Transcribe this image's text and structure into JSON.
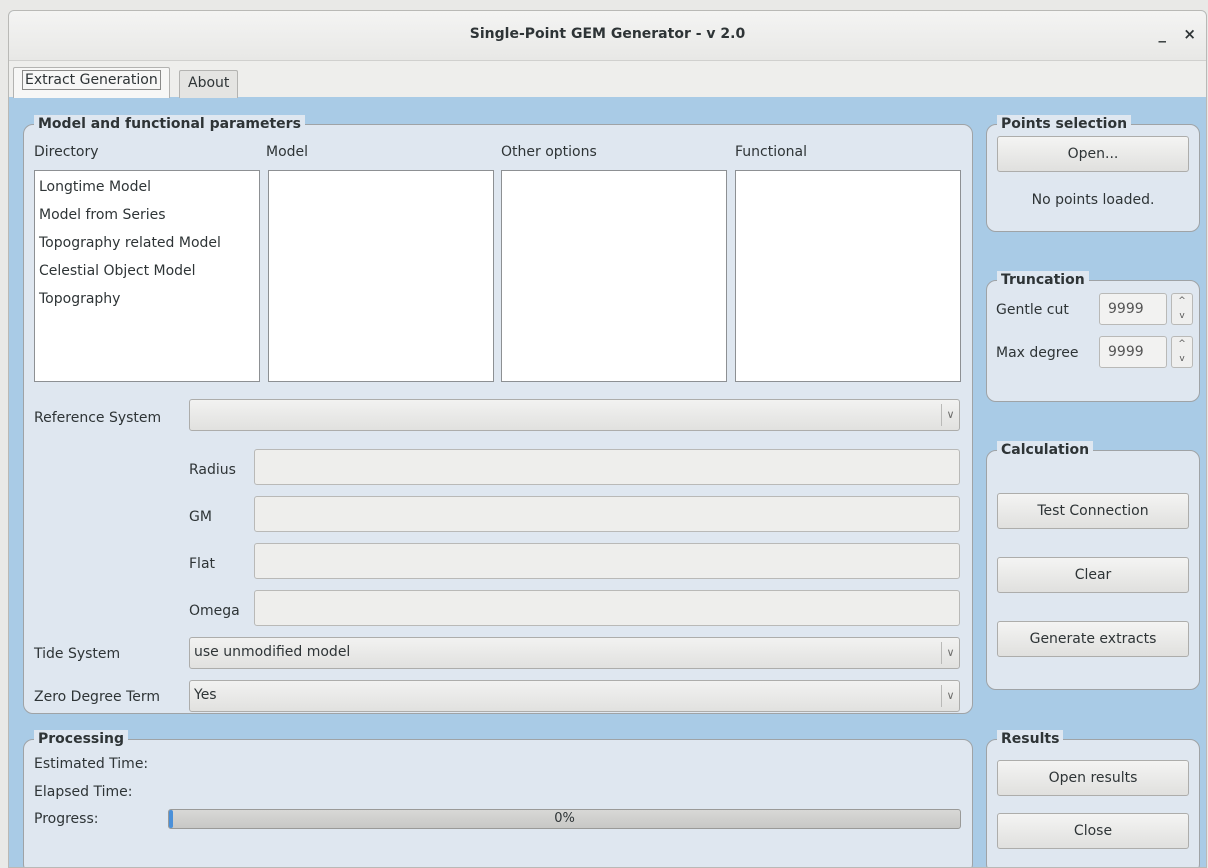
{
  "window": {
    "title": "Single-Point GEM Generator - v 2.0",
    "minimize": "_",
    "close": "×"
  },
  "tabs": [
    {
      "label": "Extract Generation"
    },
    {
      "label": "About"
    }
  ],
  "model_panel": {
    "title": "Model and functional parameters",
    "columns": {
      "directory": "Directory",
      "model": "Model",
      "other": "Other options",
      "functional": "Functional"
    },
    "directory_items": [
      "Longtime Model",
      "Model from Series",
      "Topography related Model",
      "Celestial Object Model",
      "Topography"
    ],
    "reference_system_label": "Reference System",
    "reference_system_value": "",
    "radius_label": "Radius",
    "gm_label": "GM",
    "flat_label": "Flat",
    "omega_label": "Omega",
    "tide_system_label": "Tide System",
    "tide_system_value": "use unmodified model",
    "zero_degree_label": "Zero Degree Term",
    "zero_degree_value": "Yes"
  },
  "points_panel": {
    "title": "Points selection",
    "open_button": "Open...",
    "status": "No points loaded."
  },
  "truncation_panel": {
    "title": "Truncation",
    "gentle_cut_label": "Gentle cut",
    "gentle_cut_value": "9999",
    "max_degree_label": "Max degree",
    "max_degree_value": "9999"
  },
  "calculation_panel": {
    "title": "Calculation",
    "test_button": "Test Connection",
    "clear_button": "Clear",
    "generate_button": "Generate extracts"
  },
  "processing_panel": {
    "title": "Processing",
    "estimated_label": "Estimated Time:",
    "elapsed_label": "Elapsed Time:",
    "progress_label": "Progress:",
    "progress_text": "0%",
    "progress_fraction": 0.005
  },
  "results_panel": {
    "title": "Results",
    "open_button": "Open results",
    "close_button": "Close"
  },
  "colors": {
    "background": "#a9cbe6",
    "panel": "#dfe7f0",
    "progress_fill": "#4a90d9"
  }
}
